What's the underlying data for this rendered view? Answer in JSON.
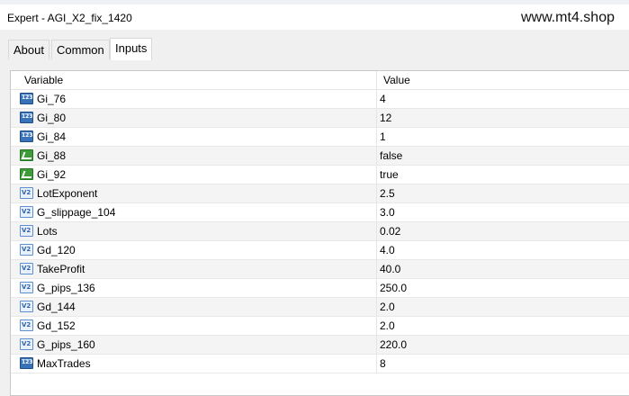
{
  "window": {
    "title": "Expert - AGI_X2_fix_1420",
    "watermark": "www.mt4.shop"
  },
  "tabs": [
    {
      "label": "About",
      "active": false
    },
    {
      "label": "Common",
      "active": false
    },
    {
      "label": "Inputs",
      "active": true
    }
  ],
  "table": {
    "columns": {
      "variable": "Variable",
      "value": "Value"
    },
    "rows": [
      {
        "name": "Gi_76",
        "value": "4",
        "type": "int-icon"
      },
      {
        "name": "Gi_80",
        "value": "12",
        "type": "int-icon"
      },
      {
        "name": "Gi_84",
        "value": "1",
        "type": "int-icon"
      },
      {
        "name": "Gi_88",
        "value": "false",
        "type": "bool-icon"
      },
      {
        "name": "Gi_92",
        "value": "true",
        "type": "bool-icon"
      },
      {
        "name": "LotExponent",
        "value": "2.5",
        "type": "double-icon"
      },
      {
        "name": "G_slippage_104",
        "value": "3.0",
        "type": "double-icon"
      },
      {
        "name": "Lots",
        "value": "0.02",
        "type": "double-icon"
      },
      {
        "name": "Gd_120",
        "value": "4.0",
        "type": "double-icon"
      },
      {
        "name": "TakeProfit",
        "value": "40.0",
        "type": "double-icon"
      },
      {
        "name": "G_pips_136",
        "value": "250.0",
        "type": "double-icon"
      },
      {
        "name": "Gd_144",
        "value": "2.0",
        "type": "double-icon"
      },
      {
        "name": "Gd_152",
        "value": "2.0",
        "type": "double-icon"
      },
      {
        "name": "G_pips_160",
        "value": "220.0",
        "type": "double-icon"
      },
      {
        "name": "MaxTrades",
        "value": "8",
        "type": "int-icon"
      }
    ]
  }
}
